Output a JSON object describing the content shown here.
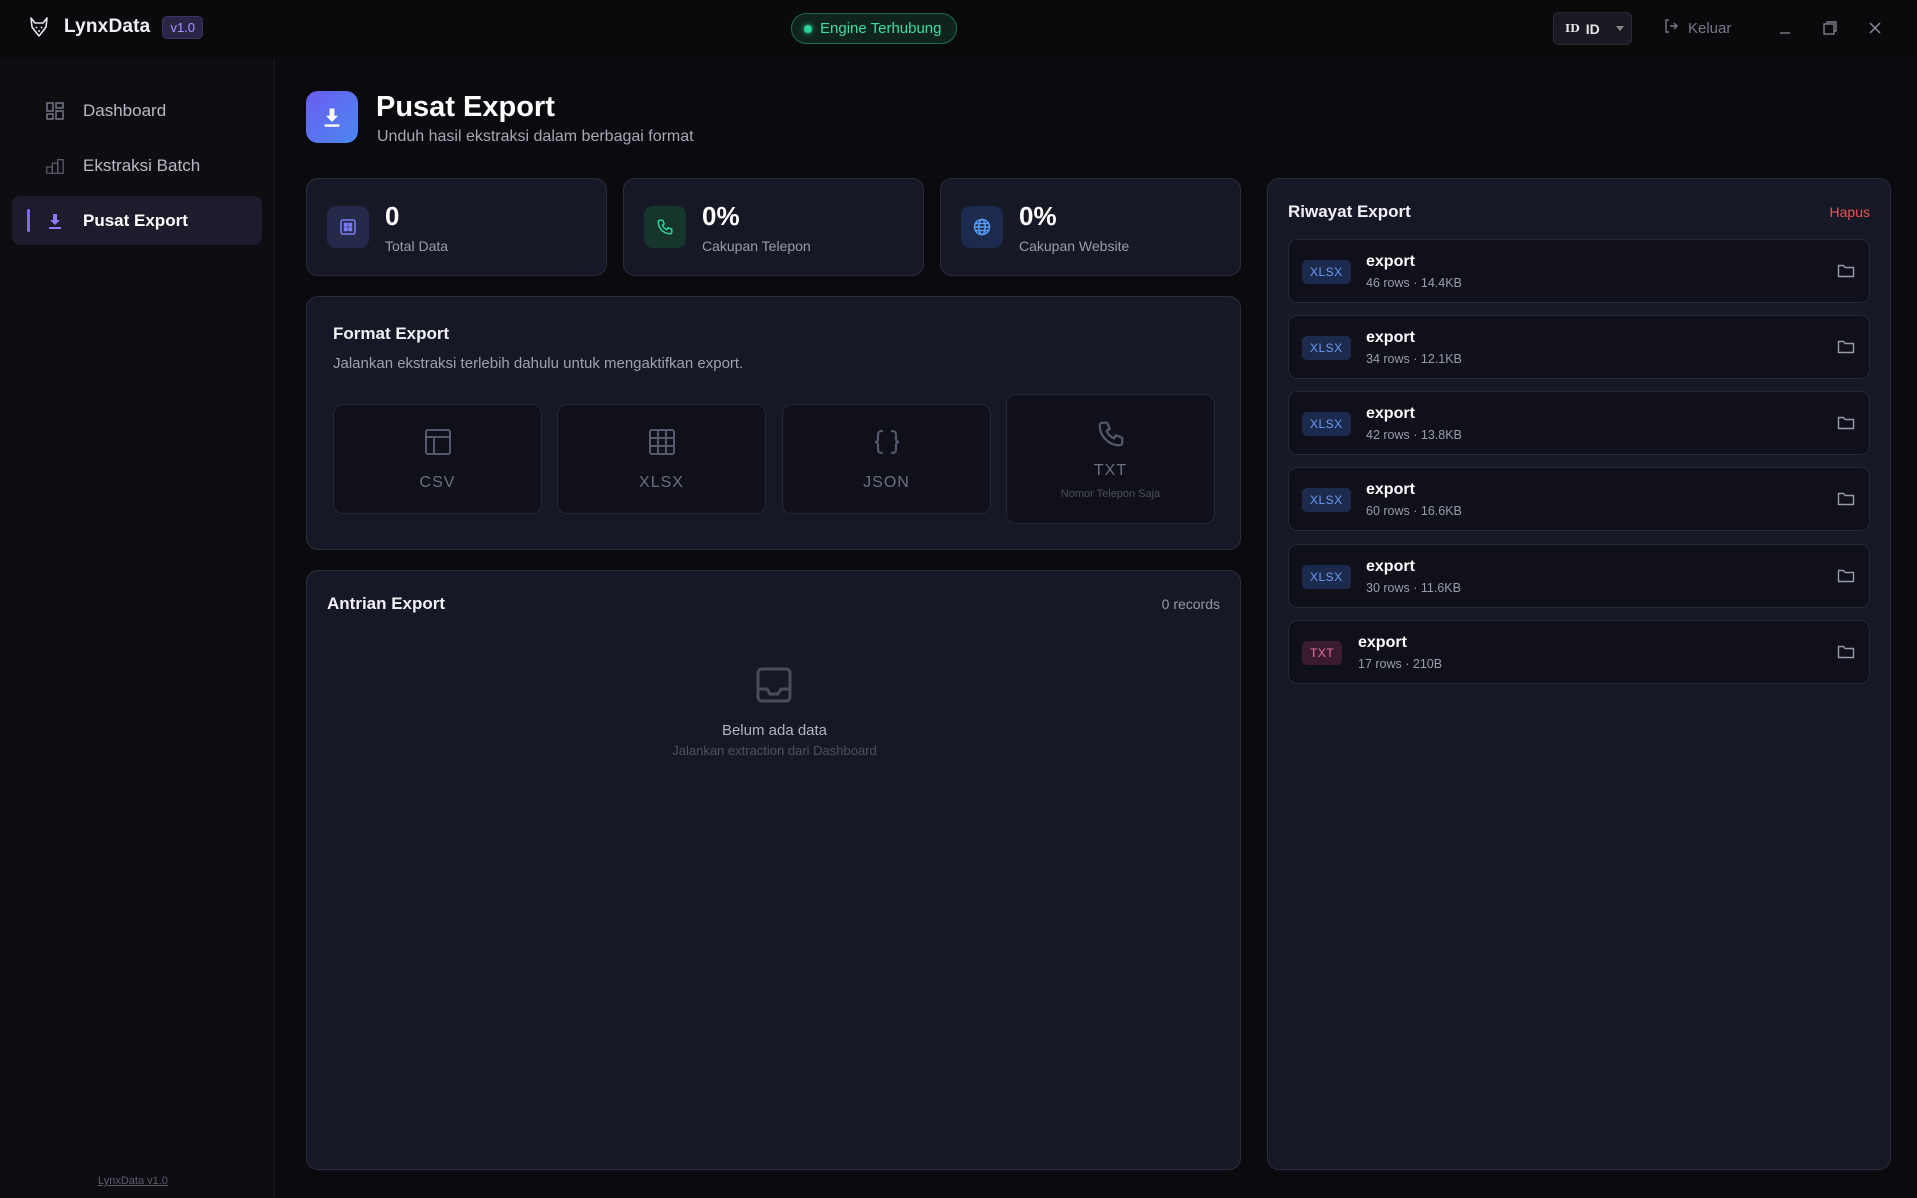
{
  "app": {
    "name": "LynxData",
    "version": "v1.0",
    "engine_status": "Engine Terhubung",
    "lang_flag": "ID",
    "lang_code": "ID",
    "logout_label": "Keluar"
  },
  "sidebar": {
    "items": [
      {
        "label": "Dashboard",
        "icon": "dashboard-icon",
        "active": false
      },
      {
        "label": "Ekstraksi Batch",
        "icon": "batch-icon",
        "active": false
      },
      {
        "label": "Pusat Export",
        "icon": "download-icon",
        "active": true
      }
    ],
    "footer": "LynxData v1.0"
  },
  "page": {
    "title": "Pusat Export",
    "subtitle": "Unduh hasil ekstraksi dalam berbagai format"
  },
  "stats": [
    {
      "value": "0",
      "label": "Total Data",
      "icon": "database-icon",
      "color": "#6d6cf0"
    },
    {
      "value": "0%",
      "label": "Cakupan Telepon",
      "icon": "phone-icon",
      "color": "#2fd59a"
    },
    {
      "value": "0%",
      "label": "Cakupan Website",
      "icon": "globe-icon",
      "color": "#5a9bf5"
    }
  ],
  "format_export": {
    "title": "Format Export",
    "description": "Jalankan ekstraksi terlebih dahulu untuk mengaktifkan export.",
    "buttons": [
      {
        "label": "CSV",
        "icon": "table-icon"
      },
      {
        "label": "XLSX",
        "icon": "grid-icon"
      },
      {
        "label": "JSON",
        "icon": "braces-icon"
      },
      {
        "label": "TXT",
        "icon": "phone-icon",
        "sublabel": "Nomor Telepon Saja"
      }
    ]
  },
  "queue": {
    "title": "Antrian Export",
    "count": "0 records",
    "empty_title": "Belum ada data",
    "empty_subtitle": "Jalankan extraction dari Dashboard"
  },
  "history": {
    "title": "Riwayat Export",
    "clear_label": "Hapus",
    "items": [
      {
        "format": "XLSX",
        "name": "export",
        "meta": "46 rows · 14.4KB"
      },
      {
        "format": "XLSX",
        "name": "export",
        "meta": "34 rows · 12.1KB"
      },
      {
        "format": "XLSX",
        "name": "export",
        "meta": "42 rows · 13.8KB"
      },
      {
        "format": "XLSX",
        "name": "export",
        "meta": "60 rows · 16.6KB"
      },
      {
        "format": "XLSX",
        "name": "export",
        "meta": "30 rows · 11.6KB"
      },
      {
        "format": "TXT",
        "name": "export",
        "meta": "17 rows · 210B"
      }
    ]
  },
  "colors": {
    "accent": "#7f6bf5",
    "success": "#2fd59a",
    "danger": "#e0585a"
  }
}
